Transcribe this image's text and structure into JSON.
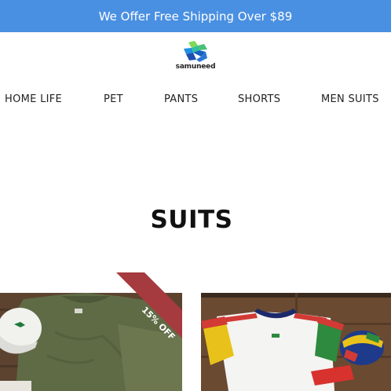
{
  "announcement": {
    "text": "We Offer Free Shipping Over $89",
    "background": "#4a90e2"
  },
  "brand": {
    "name": "samuneed",
    "icon": "cube-logo-icon"
  },
  "nav": {
    "items": [
      {
        "label": "HOME LIFE"
      },
      {
        "label": "PET"
      },
      {
        "label": "PANTS"
      },
      {
        "label": "SHORTS"
      },
      {
        "label": "MEN SUITS"
      }
    ]
  },
  "collection": {
    "title": "SUITS"
  },
  "products": [
    {
      "badge": "15% OFF",
      "badge_color": "#a53a3f",
      "image": "olive-shirt-shorts-cap-photo"
    },
    {
      "image": "colorblock-polo-hats-photo"
    }
  ]
}
